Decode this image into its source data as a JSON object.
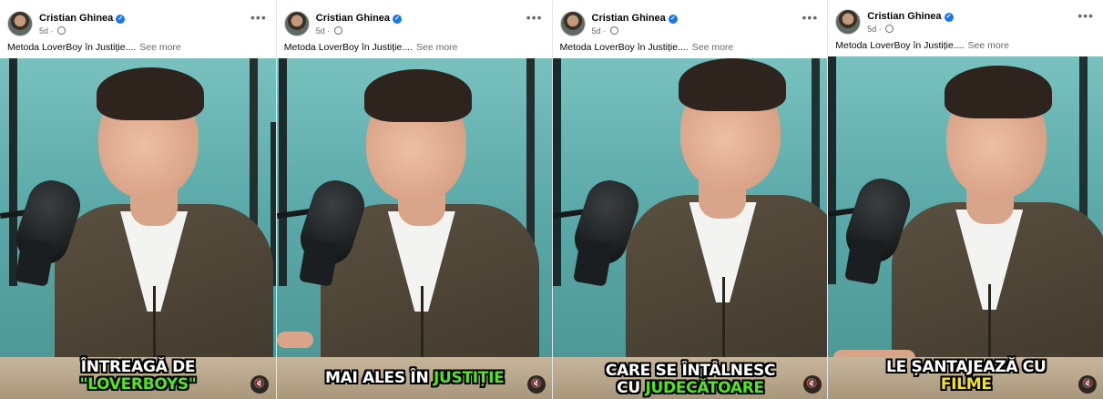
{
  "accent": "#1877f2",
  "posts": [
    {
      "author": "Cristian Ghinea",
      "time": "5d",
      "caption": "Metoda LoverBoy în Justiție....",
      "see_more": "See more",
      "subtitle_line1": "ÎNTREAGĂ DE",
      "subtitle_line2_prefix": "",
      "subtitle_highlight": "\"LOVERBOYS\"",
      "highlight_color": "#52e61f"
    },
    {
      "author": "Cristian Ghinea",
      "time": "5d",
      "caption": "Metoda LoverBoy în Justiție....",
      "see_more": "See more",
      "subtitle_line1": "",
      "subtitle_line2_prefix": "MAI ALES ÎN ",
      "subtitle_highlight": "JUSTIȚIE",
      "highlight_color": "#52e61f"
    },
    {
      "author": "Cristian Ghinea",
      "time": "5d",
      "caption": "Metoda LoverBoy în Justiție....",
      "see_more": "See more",
      "subtitle_line1": "CARE SE ÎNTÂLNESC",
      "subtitle_line2_prefix": "CU ",
      "subtitle_highlight": "JUDECĂTOARE",
      "highlight_color": "#52e61f"
    },
    {
      "author": "Cristian Ghinea",
      "time": "5d",
      "caption": "Metoda LoverBoy în Justiție....",
      "see_more": "See more",
      "subtitle_line1": "LE ȘANTAJEAZĂ CU",
      "subtitle_line2_prefix": "",
      "subtitle_highlight": "FILME",
      "highlight_color": "#f4e21b"
    }
  ],
  "icons": {
    "verified": "verified-badge-icon",
    "audience": "globe-icon",
    "menu": "more-options-icon",
    "mute": "muted-speaker-icon"
  }
}
